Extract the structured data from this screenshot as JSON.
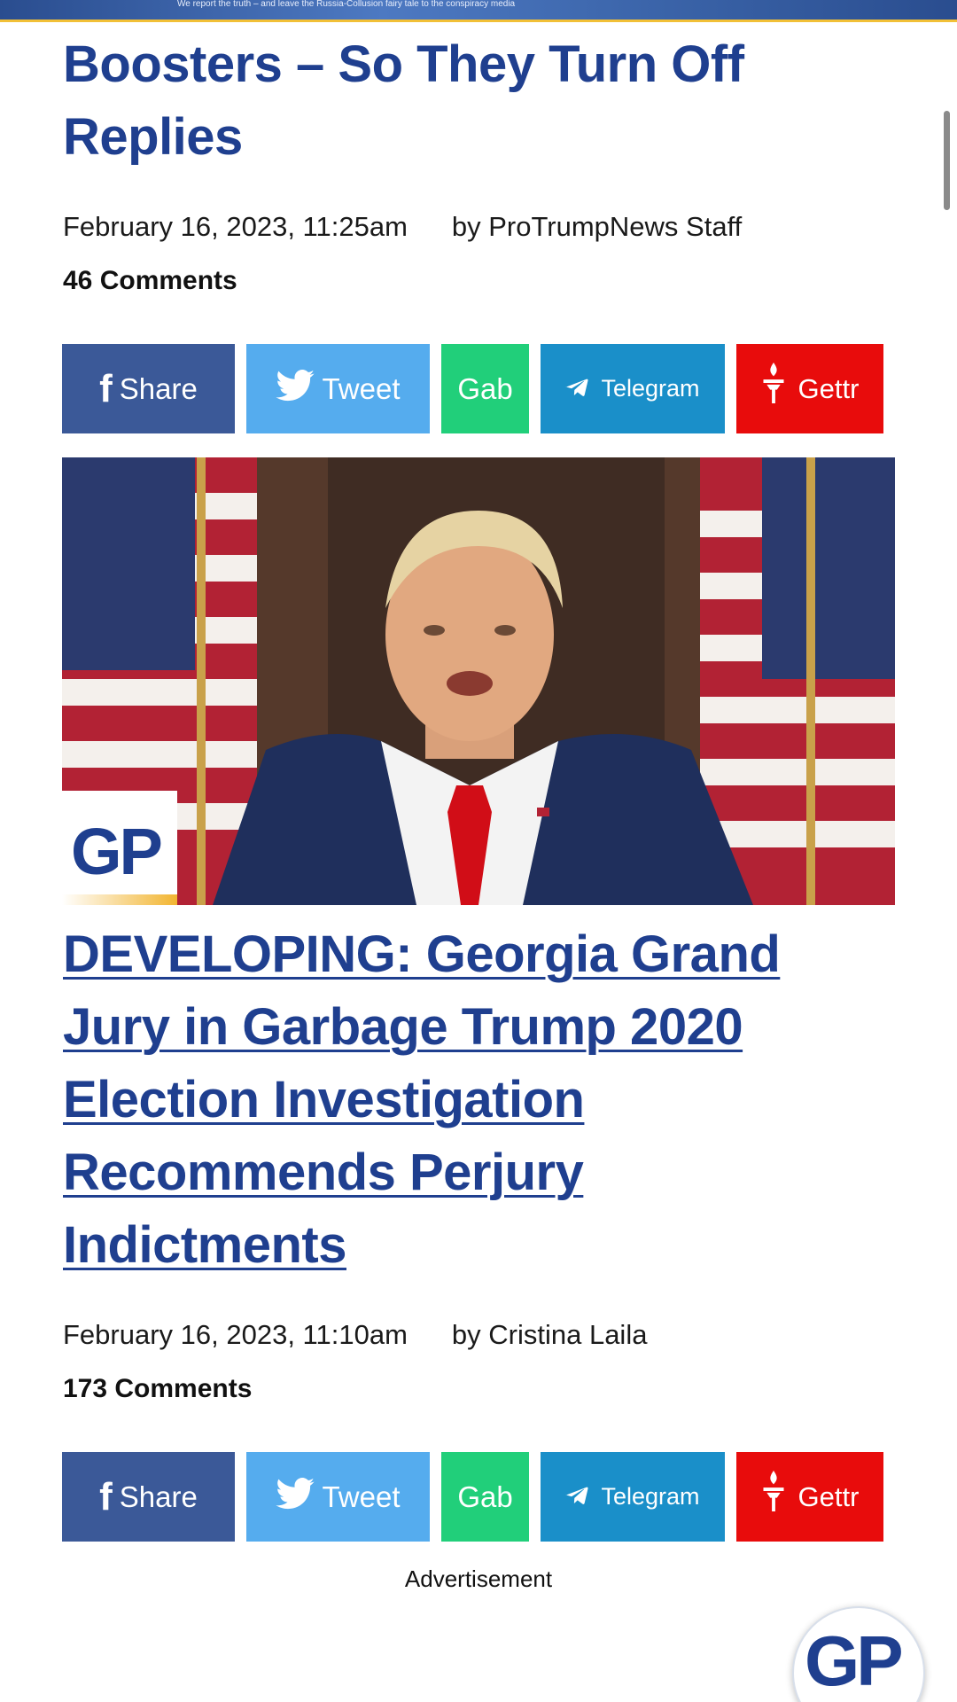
{
  "banner": {
    "text": "We report the truth – and leave the Russia-Collusion fairy tale to the conspiracy media"
  },
  "articles": [
    {
      "title": "Boosters – So They Turn Off Replies",
      "date": "February 16, 2023, 11:25am",
      "byline": "by ProTrumpNews Staff",
      "comments": "46 Comments"
    },
    {
      "title": "DEVELOPING: Georgia Grand Jury in Garbage Trump 2020 Election Investigation Recommends Perjury Indictments",
      "date": "February 16, 2023, 11:10am",
      "byline": "by Cristina Laila",
      "comments": "173 Comments",
      "image_badge": "GP"
    }
  ],
  "share": {
    "facebook": "Share",
    "twitter": "Tweet",
    "gab": "Gab",
    "telegram": "Telegram",
    "gettr": "Gettr"
  },
  "ad_label": "Advertisement",
  "floating_logo": "GP",
  "colors": {
    "headline": "#1f3f8f",
    "facebook": "#3b5998",
    "twitter": "#55acee",
    "gab": "#21cf7a",
    "telegram": "#1a8fc9",
    "gettr": "#e80c0c"
  },
  "icons": {
    "facebook": "facebook-icon",
    "twitter": "twitter-icon",
    "telegram": "telegram-icon",
    "gettr": "gettr-icon"
  }
}
